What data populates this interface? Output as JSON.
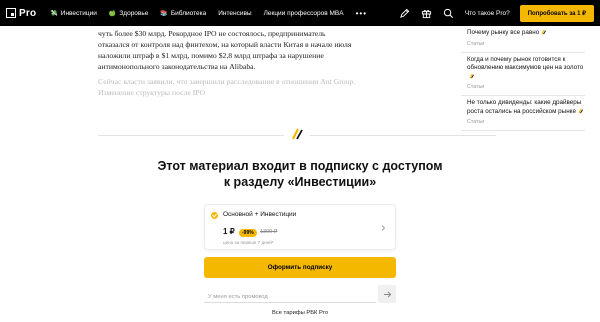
{
  "topbar": {
    "logo_text": "Pro",
    "nav": [
      {
        "emoji": "💸",
        "label": "Инвестиции"
      },
      {
        "emoji": "🍏",
        "label": "Здоровье"
      },
      {
        "emoji": "📚",
        "label": "Библиотека"
      },
      {
        "emoji": "",
        "label": "Интенсивы"
      },
      {
        "emoji": "",
        "label": "Лекции профессоров MBA"
      }
    ],
    "more_label": "•••",
    "what_is_pro": "Что такое Pro?",
    "subscribe_label": "Попробовать за 1 ₽",
    "icons": [
      "pencil-icon",
      "gift-icon",
      "search-icon"
    ]
  },
  "article": {
    "paragraph1": "чуть более $30 млрд. Рекордное IPO не состоялось, предприниматель отказался от контроля над финтехом, на который власти Китая в начале июля наложили штраф в $1 млрд, помимо $2,8 млрд штрафа за нарушение антимонопольного законодательства на Alibaba.",
    "paragraph2": "Сейчас власти заявили, что завершили расследование в отношении Ant Group. Изменение структуры после IPO"
  },
  "sidebar": {
    "items": [
      {
        "title": "Почему рынку все равно",
        "category": "Статьи"
      },
      {
        "title": "Когда и почему рынок готовится к обновлению максимумов цен на золото",
        "category": "Статьи"
      },
      {
        "title": "Не только дивиденды: какие драйверы роста остались на российском рынке",
        "category": "Статьи"
      }
    ]
  },
  "paywall": {
    "title_line1": "Этот материал входит в подписку с доступом",
    "title_line2": "к разделу «Инвестиции»",
    "plan": {
      "name": "Основной + Инвестиции",
      "price": "1 ₽",
      "discount": "-99%",
      "old_price": "1300 ₽",
      "note": "цена за первые 7 дней*"
    },
    "cta_label": "Оформить подписку",
    "promo_placeholder": "У меня есть промокод",
    "all_tariffs": "Все тарифы РБК Pro"
  },
  "colors": {
    "accent": "#f5b800",
    "topbar_bg": "#000000"
  }
}
